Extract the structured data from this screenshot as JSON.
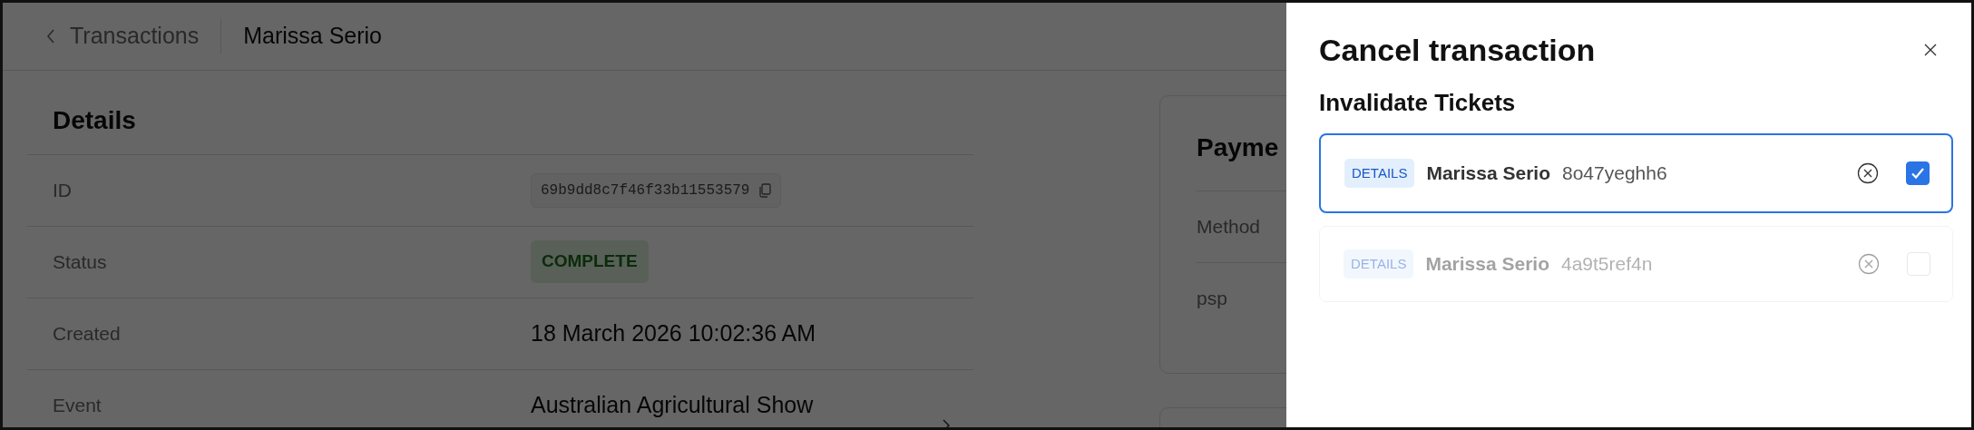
{
  "header": {
    "back_link": "Transactions",
    "title": "Marissa Serio"
  },
  "details": {
    "title": "Details",
    "rows": [
      {
        "label": "ID",
        "kind": "code",
        "value": "69b9dd8c7f46f33b11553579"
      },
      {
        "label": "Status",
        "kind": "badge",
        "value": "COMPLETE"
      },
      {
        "label": "Created",
        "kind": "text",
        "value": "18 March 2026 10:02:36 AM"
      },
      {
        "label": "Event",
        "kind": "link",
        "value": "Australian Agricultural Show"
      }
    ]
  },
  "payment": {
    "title": "Payme",
    "rows": [
      "Method",
      "psp"
    ]
  },
  "dialog": {
    "title": "Cancel transaction",
    "subtitle": "Invalidate Tickets",
    "tickets": [
      {
        "tag": "DETAILS",
        "name": "Marissa Serio",
        "code": "8o47yeghh6",
        "selected": true,
        "checked": true,
        "disabled": false
      },
      {
        "tag": "DETAILS",
        "name": "Marissa Serio",
        "code": "4a9t5ref4n",
        "selected": false,
        "checked": false,
        "disabled": true
      }
    ]
  }
}
